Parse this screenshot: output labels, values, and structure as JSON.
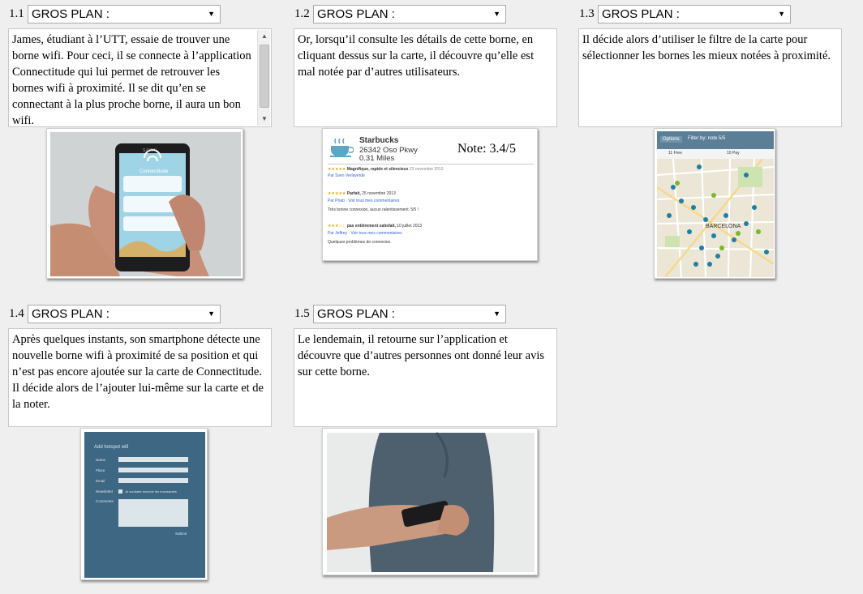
{
  "panels": [
    {
      "num": "1.1",
      "shot": "GROS PLAN :",
      "text": "James, étudiant à l’UTT, essaie de trouver une borne wifi. Pour ceci, il se connecte à l’application Connectitude qui lui permet de retrouver les bornes wifi à proximité. Il se dit qu’en se connectant à la plus proche borne, il aura un bon wifi."
    },
    {
      "num": "1.2",
      "shot": "GROS PLAN :",
      "text": "Or, lorsqu’il consulte les détails de cette borne, en cliquant dessus sur la carte, il découvre qu’elle est mal notée par d’autres utilisateurs."
    },
    {
      "num": "1.3",
      "shot": "GROS PLAN :",
      "text": " Il décide alors d’utiliser le filtre de la carte pour sélectionner les bornes les mieux notées à proximité."
    },
    {
      "num": "1.4",
      "shot": "GROS PLAN :",
      "text": "Après quelques instants, son smartphone détecte une nouvelle borne wifi à proximité de sa position et qui n’est pas encore ajoutée sur la carte de Connectitude. Il décide alors de l’ajouter lui-même sur la carte et de la noter."
    },
    {
      "num": "1.5",
      "shot": "GROS PLAN :",
      "text": "Le lendemain, il retourne sur l’application et découvre que d’autres personnes ont donné leur avis sur cette borne."
    }
  ],
  "phone": {
    "brand": "SONY",
    "app_name": "Connectitude"
  },
  "review": {
    "place": "Starbucks",
    "address": "26342 Oso Pkwy",
    "distance": "0.31 Miles",
    "note": "Note: 3.4/5",
    "r1_title": "Magnifique, rapide et silencieux",
    "r1_date": "23 novembre 2013",
    "r1_author": "Par Sven Verlaverde",
    "r2_title": "Parfait,",
    "r2_date": "25 novembre 2013",
    "r2_author": "Par Phab · Voir tous mes commentaires",
    "r2_body": "Très bonne connexion, aucun ralentissement. 5/5 !",
    "r3_title": "pas entièrement satisfait,",
    "r3_date": "10 juillet 2013",
    "r3_author": "Par Jeffrey · Voir tous mes commentaires",
    "r3_body": "Quelques problèmes de connexion."
  },
  "map": {
    "options_tab": "Options",
    "filter_tab": "Filter by: note 5/5",
    "free_label": "11 Free",
    "pay_label": "10 Pay",
    "city_label": "BARCELONA",
    "colors": {
      "blue_pin": "#1f7fa0",
      "green_pin": "#7ab82a",
      "header": "#5b7f97"
    }
  },
  "form": {
    "title": "Add hotspot wifi",
    "name_label": "Name",
    "place_label": "Place",
    "email_label": "Email",
    "newsletter_label": "Newsletter",
    "newsletter_text": "Je souhaite recevoir les nouveautés",
    "comments_label": "Comments",
    "submit": "Submit"
  },
  "colors": {
    "accent_star": "#e8a200",
    "link": "#3366cc"
  }
}
